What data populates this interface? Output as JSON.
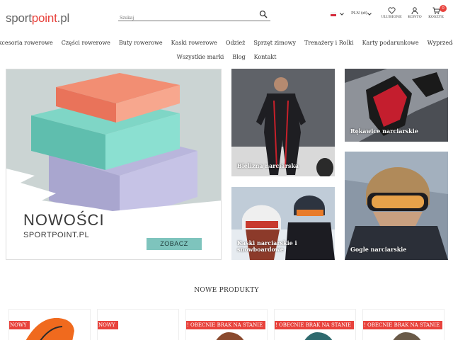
{
  "header": {
    "logo_main": "sport",
    "logo_accent": "point",
    "logo_tld": ".pl",
    "search_placeholder": "Szukaj",
    "currency": "PLN (zł)",
    "wishlist_label": "ULUBIONE",
    "account_label": "KONTO",
    "cart_label": "KOSZYK",
    "cart_count": "0",
    "icons": [
      "search-icon",
      "heart-icon",
      "user-icon",
      "cart-icon",
      "poland-flag-icon",
      "chevron-down-icon"
    ]
  },
  "nav": {
    "row1": [
      "Akcesoria rowerowe",
      "Części rowerowe",
      "Buty rowerowe",
      "Kaski rowerowe",
      "Odzież",
      "Sprzęt zimowy",
      "Trenażery i Rolki",
      "Karty podarunkowe",
      "Wyprzedaż"
    ],
    "row2": [
      "Wszystkie marki",
      "Blog",
      "Kontakt"
    ]
  },
  "hero": {
    "title": "NOWOŚCI",
    "subtitle": "SPORTPOINT.PL",
    "cta": "ZOBACZ"
  },
  "tiles": [
    {
      "caption": "Bielizna narciarska"
    },
    {
      "caption": "Rękawice narciarskie"
    },
    {
      "caption": "Kaski narciarskie i snowboardowe"
    },
    {
      "caption": "Gogle narciarskie"
    }
  ],
  "new_products": {
    "title": "NOWE PRODUKTY",
    "items": [
      {
        "tag": "NOWY"
      },
      {
        "tag": "NOWY"
      },
      {
        "tag": "! OBECNIE BRAK NA STANIE"
      },
      {
        "tag": "! OBECNIE BRAK NA STANIE"
      },
      {
        "tag": "! OBECNIE BRAK NA STANIE"
      }
    ]
  },
  "colors": {
    "accent": "#e8423c",
    "cta": "#7ec4bd"
  }
}
